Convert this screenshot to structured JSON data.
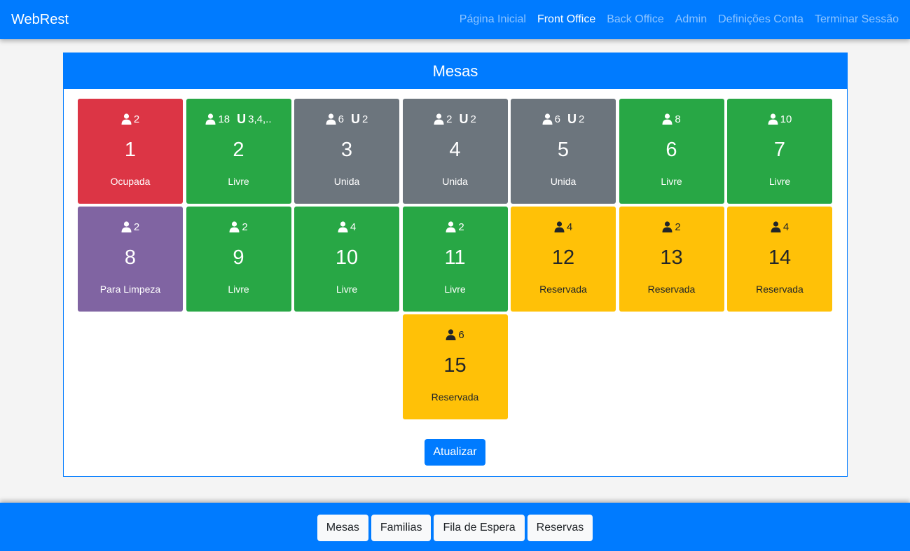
{
  "navbar": {
    "brand": "WebRest",
    "links": [
      {
        "label": "Página Inicial",
        "active": false
      },
      {
        "label": "Front Office",
        "active": true
      },
      {
        "label": "Back Office",
        "active": false
      },
      {
        "label": "Admin",
        "active": false
      },
      {
        "label": "Definições Conta",
        "active": false
      },
      {
        "label": "Terminar Sessão",
        "active": false
      }
    ]
  },
  "panel": {
    "title": "Mesas",
    "refresh_label": "Atualizar"
  },
  "colors": {
    "primary": "#007bff",
    "Ocupada": "#dc3545",
    "Livre": "#28a745",
    "Unida": "#6c757d",
    "Para Limpeza": "#8064a2",
    "Reservada": "#ffc107"
  },
  "icons": {
    "person": "person-icon",
    "link": "link-icon"
  },
  "tables": [
    {
      "number": "1",
      "seats": "2",
      "linked": null,
      "status": "Ocupada"
    },
    {
      "number": "2",
      "seats": "18",
      "linked": "3,4,..",
      "status": "Livre"
    },
    {
      "number": "3",
      "seats": "6",
      "linked": "2",
      "status": "Unida"
    },
    {
      "number": "4",
      "seats": "2",
      "linked": "2",
      "status": "Unida"
    },
    {
      "number": "5",
      "seats": "6",
      "linked": "2",
      "status": "Unida"
    },
    {
      "number": "6",
      "seats": "8",
      "linked": null,
      "status": "Livre"
    },
    {
      "number": "7",
      "seats": "10",
      "linked": null,
      "status": "Livre"
    },
    {
      "number": "8",
      "seats": "2",
      "linked": null,
      "status": "Para Limpeza"
    },
    {
      "number": "9",
      "seats": "2",
      "linked": null,
      "status": "Livre"
    },
    {
      "number": "10",
      "seats": "4",
      "linked": null,
      "status": "Livre"
    },
    {
      "number": "11",
      "seats": "2",
      "linked": null,
      "status": "Livre"
    },
    {
      "number": "12",
      "seats": "4",
      "linked": null,
      "status": "Reservada"
    },
    {
      "number": "13",
      "seats": "2",
      "linked": null,
      "status": "Reservada"
    },
    {
      "number": "14",
      "seats": "4",
      "linked": null,
      "status": "Reservada"
    },
    {
      "number": "15",
      "seats": "6",
      "linked": null,
      "status": "Reservada"
    }
  ],
  "footer": {
    "buttons": [
      "Mesas",
      "Familias",
      "Fila de Espera",
      "Reservas"
    ]
  }
}
